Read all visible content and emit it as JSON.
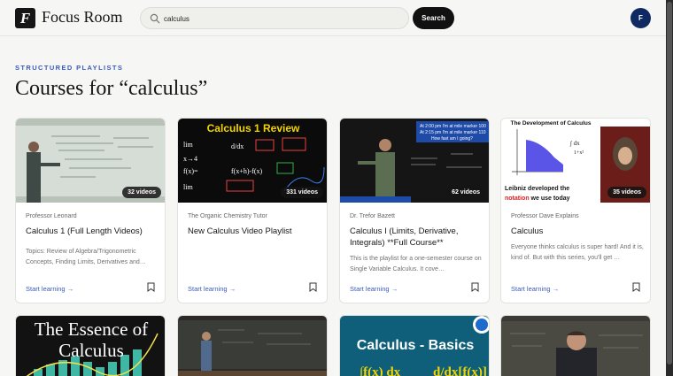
{
  "app": {
    "logo_letter": "F",
    "name": "Focus Room"
  },
  "search": {
    "value": "calculus",
    "button": "Search"
  },
  "user": {
    "initial": "F"
  },
  "section": {
    "eyebrow": "STRUCTURED PLAYLISTS",
    "title": "Courses for “calculus”"
  },
  "cards": [
    {
      "author": "Professor Leonard",
      "title": "Calculus 1 (Full Length Videos)",
      "description": "Topics: Review of Algebra/Trigonometric Concepts, Finding Limits, Derivatives and…",
      "badge": "32 videos",
      "action": "Start learning →"
    },
    {
      "author": "The Organic Chemistry Tutor",
      "title": "New Calculus Video Playlist",
      "description": "",
      "badge": "331 videos",
      "action": "Start learning →",
      "thumb_text": "Calculus 1 Review"
    },
    {
      "author": "Dr. Trefor Bazett",
      "title": "Calculus I (Limits, Derivative, Integrals) **Full Course**",
      "description": "This is the playlist for a one-semester course on Single Variable Calculus. It cove…",
      "badge": "62 videos",
      "action": "Start learning →",
      "thumb_lines": [
        "At 2:00 pm I'm at mile marker 100",
        "At 2:15 pm I'm at mile marker 110",
        "How fast am I going?"
      ]
    },
    {
      "author": "Professor Dave Explains",
      "title": "Calculus",
      "description": "Everyone thinks calculus is super hard! And it is, kind of. But with this series, you'll get …",
      "badge": "35 videos",
      "action": "Start learning →",
      "thumb_title": "The Development of Calculus",
      "thumb_caption_1": "Leibniz developed the",
      "thumb_caption_2a": "notation",
      "thumb_caption_2b": " we use today"
    }
  ],
  "row2": [
    {
      "thumb_text_1": "The Essence of",
      "thumb_text_2": "Calculus"
    },
    {
      "thumb_text": ""
    },
    {
      "thumb_text": "Calculus - Basics"
    },
    {
      "thumb_text": ""
    }
  ],
  "colors": {
    "accent": "#3a5bbf",
    "avatar": "#0f2a63",
    "ink": "#161616"
  }
}
